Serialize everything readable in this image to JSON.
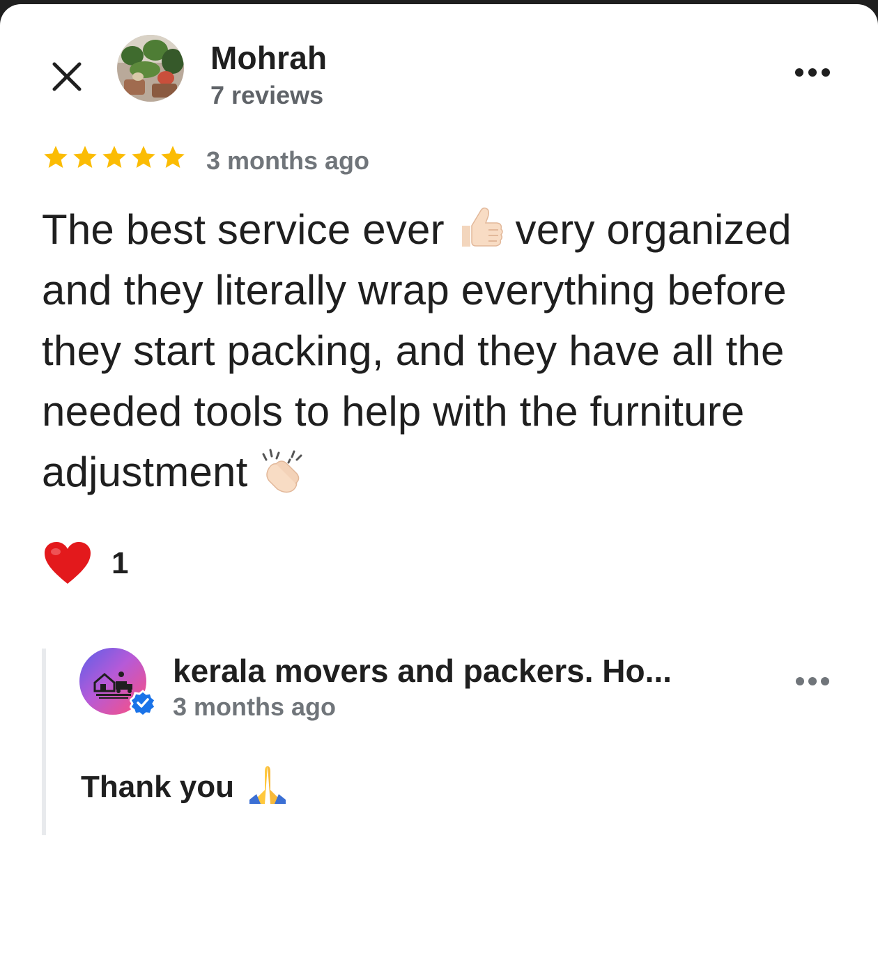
{
  "reviewer": {
    "name": "Mohrah",
    "review_count": "7 reviews",
    "avatar_icon": "plants-photo-avatar"
  },
  "review": {
    "rating": 5,
    "rating_max": 5,
    "star_color": "#fbbc04",
    "date": "3 months ago",
    "text_part1": "The best service ever",
    "emoji1": "thumbs-up-emoji",
    "text_part2": "very organized and they literally wrap everything before they start packing, and they have all the needed tools to help with the furniture adjustment",
    "emoji2": "clapping-hands-emoji"
  },
  "reaction": {
    "icon": "red-heart-emoji",
    "count": "1"
  },
  "owner_reply": {
    "name": "kerala movers and packers. Ho...",
    "date": "3 months ago",
    "text": "Thank you",
    "emoji": "folded-hands-emoji",
    "verified_icon": "verified-badge-icon",
    "avatar_icon": "moving-truck-logo"
  },
  "icons": {
    "close": "close-icon",
    "more": "more-horizontal-icon"
  },
  "colors": {
    "text_primary": "#1f1f1f",
    "text_secondary": "#70757a",
    "verified_blue": "#1a73e8"
  }
}
